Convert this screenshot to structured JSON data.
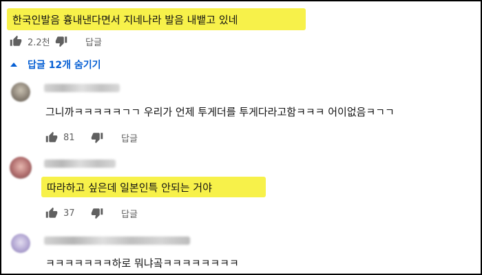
{
  "top_comment": {
    "text": "한국인발음 흉내낸다면서 지네나라 발음 내뱉고 있네",
    "likes": "2.2천",
    "reply_label": "답글"
  },
  "replies_toggle": {
    "label": "답글 12개 숨기기"
  },
  "replies": [
    {
      "text": "그니까ㅋㅋㅋㅋㅋㄱㄱ 우리가 언제 투게더를 투게다라고함ㅋㅋㅋ 어이없음ㅋㄱㄱ",
      "likes": "81",
      "reply_label": "답글"
    },
    {
      "text": "따라하고 싶은데 일본인특 안되는 거야",
      "likes": "37",
      "reply_label": "답글"
    },
    {
      "text": "ㅋㅋㅋㅋㅋㅋㅋ하로 뭐냐곸ㅋㅋㅋㅋㅋㅋㅋㅋ"
    }
  ],
  "icons": {
    "like": "thumbs-up-icon",
    "dislike": "thumbs-down-icon",
    "toggle": "caret-up-icon"
  },
  "colors": {
    "highlight": "#f7f14a",
    "link": "#065fd4",
    "secondary_text": "#606060"
  }
}
